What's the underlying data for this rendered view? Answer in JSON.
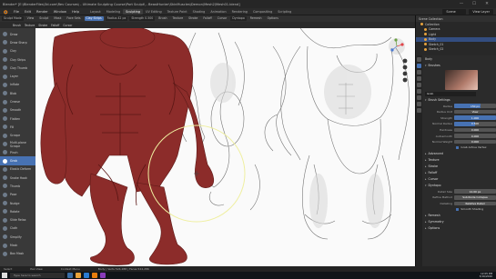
{
  "window": {
    "title": "Blender* [E:\\BlenderFiles\\3d.com\\Rev Courses\\ - Ultimate Sculpting Course\\Part Sculpt\\ - BeastHunter\\SkinMuscles\\Demon\\Mesh2\\Mesh01.blend]",
    "minimize": "—",
    "maximize": "☐",
    "close": "✕"
  },
  "menu": {
    "items": [
      "File",
      "Edit",
      "Render",
      "Window",
      "Help"
    ]
  },
  "workspaces": {
    "tabs": [
      "Layout",
      "Modeling",
      "Sculpting",
      "UV Editing",
      "Texture Paint",
      "Shading",
      "Animation",
      "Rendering",
      "Compositing",
      "Scripting"
    ],
    "active": "Sculpting"
  },
  "scene_fields": {
    "scene": "Scene",
    "view_layer": "View Layer"
  },
  "header": {
    "mode": "Sculpt Mode",
    "view": "View",
    "sculpt": "Sculpt",
    "mask": "Mask",
    "face_sets": "Face Sets",
    "brush": "Clay Strips",
    "radius": "Radius 42 px",
    "strength": "Strength 0.500",
    "options": "Options",
    "dyntopo": "Dyntopo",
    "remesh": "Remesh",
    "brush_settings": "Brush",
    "texture": "Texture",
    "stroke": "Stroke",
    "falloff": "Falloff",
    "cursor": "Cursor"
  },
  "tool_settings": {
    "items": [
      "Brush",
      "Texture",
      "Stroke",
      "Falloff",
      "Cursor"
    ]
  },
  "tools": [
    {
      "label": "Draw"
    },
    {
      "label": "Draw Sharp"
    },
    {
      "label": "Clay"
    },
    {
      "label": "Clay Strips"
    },
    {
      "label": "Clay Thumb"
    },
    {
      "label": "Layer"
    },
    {
      "label": "Inflate"
    },
    {
      "label": "Blob"
    },
    {
      "label": "Crease"
    },
    {
      "label": "Smooth"
    },
    {
      "label": "Flatten"
    },
    {
      "label": "Fill"
    },
    {
      "label": "Scrape"
    },
    {
      "label": "Multi-plane Scrape"
    },
    {
      "label": "Pinch"
    },
    {
      "label": "Grab"
    },
    {
      "label": "Elastic Deform"
    },
    {
      "label": "Snake Hook"
    },
    {
      "label": "Thumb"
    },
    {
      "label": "Pose"
    },
    {
      "label": "Nudge"
    },
    {
      "label": "Rotate"
    },
    {
      "label": "Slide Relax"
    },
    {
      "label": "Cloth"
    },
    {
      "label": "Simplify"
    },
    {
      "label": "Mask"
    },
    {
      "label": "Box Mask"
    }
  ],
  "active_tool": "Grab",
  "outliner": {
    "header": "Scene Collection",
    "rows": [
      "Collection",
      "Camera",
      "Light",
      "Body",
      "Sketch_01",
      "Sketch_02"
    ]
  },
  "properties": {
    "object_name": "Body",
    "brushes_section": "Brushes",
    "brush_name": "Grab",
    "brush_settings_section": "Brush Settings",
    "rows": [
      {
        "label": "Radius",
        "value": "150 px",
        "fill": 0.62
      },
      {
        "label": "Radius Unit",
        "value": "View",
        "fill": 0.0
      },
      {
        "label": "Strength",
        "value": "1.000",
        "fill": 1.0
      },
      {
        "label": "Normal Radius",
        "value": "0.500",
        "fill": 0.5
      },
      {
        "label": "Hardness",
        "value": "0.000",
        "fill": 0.0
      },
      {
        "label": "Autosmooth",
        "value": "0.000",
        "fill": 0.0
      },
      {
        "label": "Normal Weight",
        "value": "0.000",
        "fill": 0.0
      }
    ],
    "grab_active_label": "Grab Active Vertex",
    "collapsed_sections": [
      "Advanced",
      "Texture",
      "Stroke",
      "Falloff",
      "Cursor"
    ],
    "dyntopo_section": "Dyntopo",
    "dyntopo_rows": [
      {
        "label": "Detail Size",
        "value": "12.00 px"
      },
      {
        "label": "Refine Method",
        "value": "Subdivide Collapse"
      },
      {
        "label": "Detailing",
        "value": "Relative Detail"
      }
    ],
    "smooth_shading": "Smooth Shading",
    "bottom_sections": [
      "Remesh",
      "Symmetry",
      "Options"
    ]
  },
  "statusbar": {
    "items": [
      "Select",
      "Pan View",
      "Context Menu",
      "Body | Verts 524,288 | Faces 524,286"
    ]
  },
  "taskbar": {
    "search_placeholder": "Type here to search",
    "time": "12:05 PM",
    "date": "3/16/2020"
  },
  "colors": {
    "accent": "#4772b3",
    "skin": "#8c2c2a",
    "cursor_ring": "#efefa0"
  }
}
